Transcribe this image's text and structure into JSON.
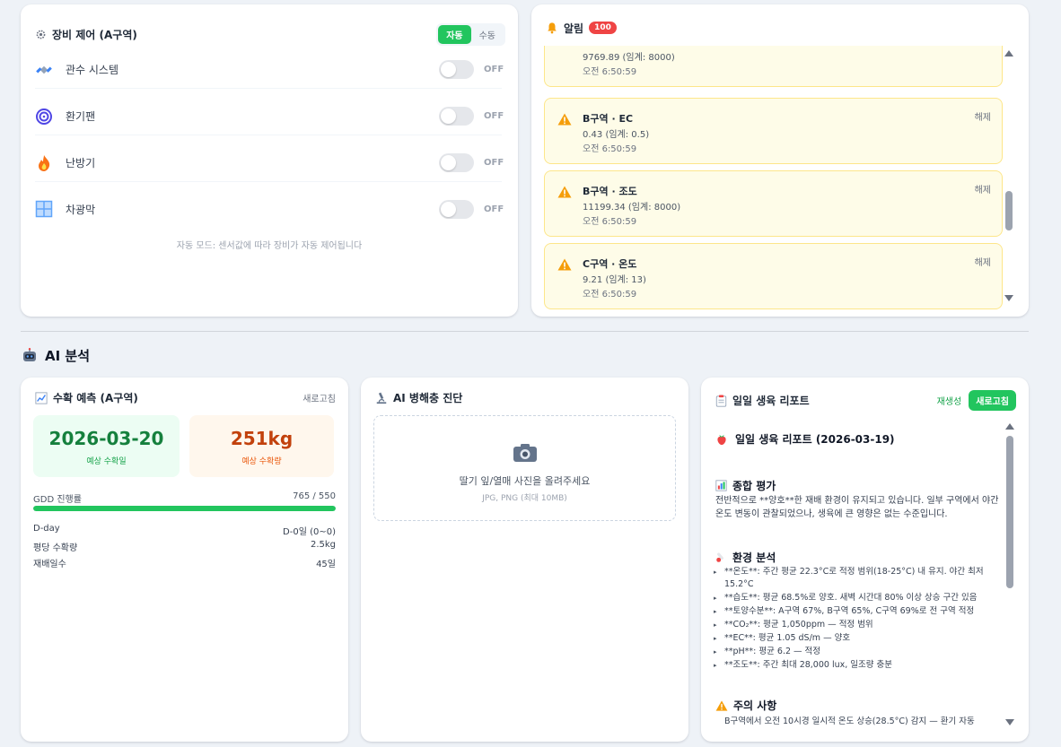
{
  "equipment": {
    "title": "장비 제어 (A구역)",
    "mode_auto": "자동",
    "mode_manual": "수동",
    "devices": [
      {
        "name": "관수 시스템",
        "state": "OFF",
        "icon": "satellite-icon"
      },
      {
        "name": "환기팬",
        "state": "OFF",
        "icon": "cyclone-icon"
      },
      {
        "name": "난방기",
        "state": "OFF",
        "icon": "fire-icon"
      },
      {
        "name": "차광막",
        "state": "OFF",
        "icon": "window-icon"
      }
    ],
    "auto_note": "자동 모드: 센서값에 따라 장비가 자동 제어됩니다"
  },
  "alerts": {
    "title": "알림",
    "count": "100",
    "items": [
      {
        "title": "",
        "value": "9769.89 (임계: 8000)",
        "time": "오전 6:50:59",
        "dismiss": ""
      },
      {
        "title": "B구역 · EC",
        "value": "0.43 (임계: 0.5)",
        "time": "오전 6:50:59",
        "dismiss": "해제"
      },
      {
        "title": "B구역 · 조도",
        "value": "11199.34 (임계: 8000)",
        "time": "오전 6:50:59",
        "dismiss": "해제"
      },
      {
        "title": "C구역 · 온도",
        "value": "9.21 (임계: 13)",
        "time": "오전 6:50:59",
        "dismiss": "해제"
      }
    ]
  },
  "ai_section": {
    "title": "AI 분석"
  },
  "harvest": {
    "title": "수확 예측 (A구역)",
    "refresh": "새로고침",
    "date": "2026-03-20",
    "date_label": "예상 수확일",
    "yield": "251kg",
    "yield_label": "예상 수확량",
    "gdd_label": "GDD 진행률",
    "gdd_value": "765 / 550",
    "gdd_progress": 1.0,
    "rows": [
      {
        "label": "D-day",
        "value": "D-0일 (0~0)"
      },
      {
        "label": "평당 수확량",
        "value": "2.5kg"
      },
      {
        "label": "재배일수",
        "value": "45일"
      }
    ]
  },
  "pest": {
    "title": "AI 병해충 진단",
    "upload_main": "딸기 잎/열매 사진을 올려주세요",
    "upload_sub": "JPG, PNG (최대 10MB)"
  },
  "report": {
    "title": "일일 생육 리포트",
    "regenerate": "재생성",
    "refresh": "새로고침",
    "doc_title": "일일 생육 리포트 (2026-03-19)",
    "overall_heading": "종합 평가",
    "overall_text": "전반적으로 **양호**한 재배 환경이 유지되고 있습니다. 일부 구역에서 야간 온도 변동이 관찰되었으나, 생육에 큰 영향은 없는 수준입니다.",
    "env_heading": "환경 분석",
    "env_items": [
      "**온도**: 주간 평균 22.3°C로 적정 범위(18-25°C) 내 유지. 야간 최저 15.2°C",
      "**습도**: 평균 68.5%로 양호. 새벽 시간대 80% 이상 상승 구간 있음",
      "**토양수분**: A구역 67%, B구역 65%, C구역 69%로 전 구역 적정",
      "**CO₂**: 평균 1,050ppm — 적정 범위",
      "**EC**: 평균 1.05 dS/m — 양호",
      "**pH**: 평균 6.2 — 적정",
      "**조도**: 주간 최대 28,000 lux, 일조량 충분"
    ],
    "caution_heading": "주의 사항",
    "caution_items": [
      "B구역에서 오전 10시경 일시적 온도 상승(28.5°C) 감지 — 환기 자동"
    ]
  }
}
